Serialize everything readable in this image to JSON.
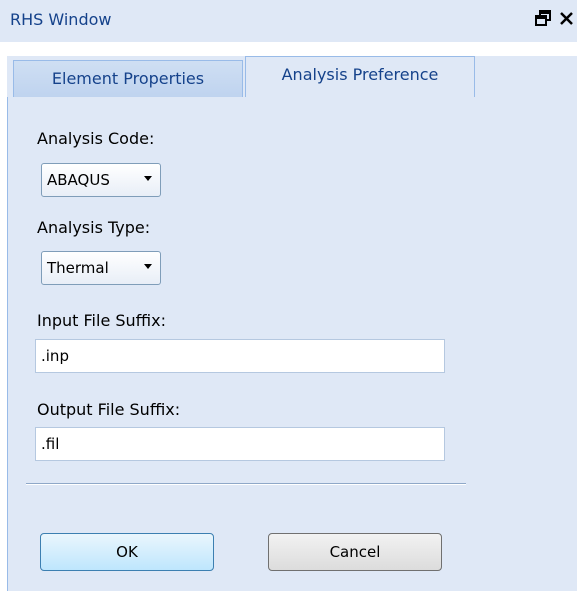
{
  "window": {
    "title": "RHS Window"
  },
  "tabs": [
    {
      "label": "Element Properties",
      "active": false
    },
    {
      "label": "Analysis Preference",
      "active": true
    }
  ],
  "form": {
    "analysis_code_label": "Analysis Code:",
    "analysis_code_value": "ABAQUS",
    "analysis_type_label": "Analysis Type:",
    "analysis_type_value": "Thermal",
    "input_suffix_label": "Input File Suffix:",
    "input_suffix_value": ".inp",
    "output_suffix_label": "Output File Suffix:",
    "output_suffix_value": ".fil"
  },
  "buttons": {
    "ok_label": "OK",
    "cancel_label": "Cancel"
  },
  "icons": {
    "restore": "restore-icon",
    "close": "close-icon",
    "dropdown": "chevron-down-icon"
  },
  "colors": {
    "panel_bg": "#dfe8f6",
    "title_text": "#15428b",
    "border": "#99bbe8",
    "ok_button": "#bee6fd"
  }
}
